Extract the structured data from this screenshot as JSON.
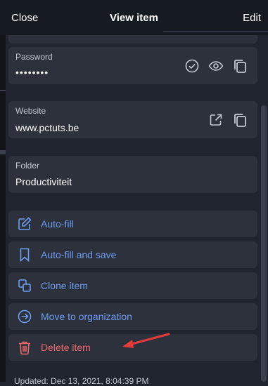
{
  "header": {
    "close_label": "Close",
    "title": "View item",
    "edit_label": "Edit"
  },
  "fields": {
    "password": {
      "label": "Password",
      "value": "••••••••"
    },
    "website": {
      "label": "Website",
      "value": "www.pctuts.be"
    },
    "folder": {
      "label": "Folder",
      "value": "Productiviteit"
    }
  },
  "actions": [
    {
      "label": "Auto-fill",
      "icon": "edit-icon"
    },
    {
      "label": "Auto-fill and save",
      "icon": "bookmark-icon"
    },
    {
      "label": "Clone item",
      "icon": "clone-icon"
    },
    {
      "label": "Move to organization",
      "icon": "arrow-circle-icon"
    },
    {
      "label": "Delete item",
      "icon": "trash-icon"
    }
  ],
  "footer": {
    "text": "Updated: Dec 13, 2021, 8:04:39 PM"
  },
  "colors": {
    "accent": "#6d9cf2",
    "danger": "#ef6a6a",
    "annotation_arrow": "#e23b3b"
  }
}
